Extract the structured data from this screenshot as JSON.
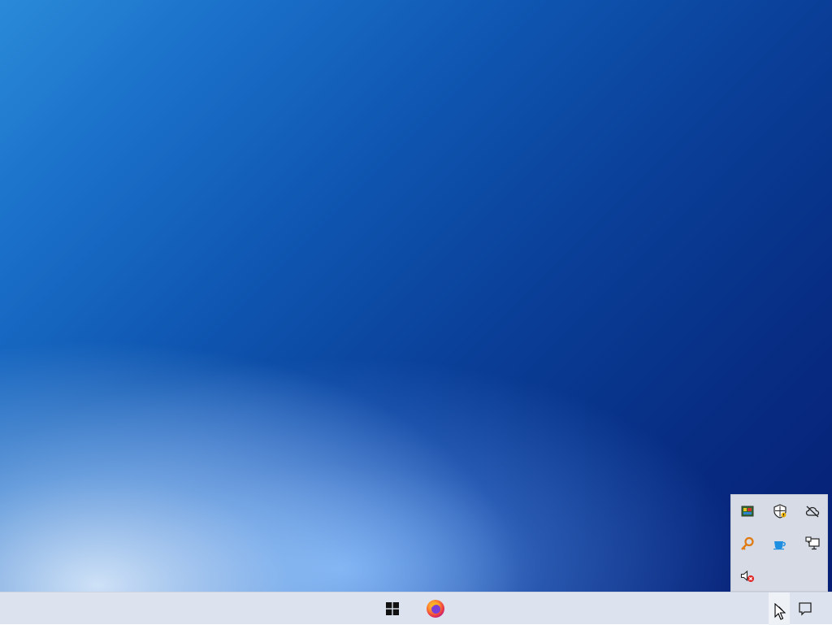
{
  "desktop": {
    "wallpaper": "blue-gradient"
  },
  "tray_overflow": {
    "icons": [
      {
        "name": "image-app-icon",
        "tooltip": ""
      },
      {
        "name": "security-shield-icon",
        "tooltip": ""
      },
      {
        "name": "cloud-offline-icon",
        "tooltip": ""
      },
      {
        "name": "key-icon",
        "tooltip": ""
      },
      {
        "name": "cup-icon",
        "tooltip": ""
      },
      {
        "name": "network-monitor-icon",
        "tooltip": ""
      },
      {
        "name": "speaker-muted-icon",
        "tooltip": ""
      }
    ]
  },
  "taskbar": {
    "apps": [
      {
        "name": "windows-start-icon"
      },
      {
        "name": "firefox-icon"
      }
    ],
    "tray": {
      "show_hidden_icons": "chevron-up-icon",
      "action_center": "notification-icon"
    }
  },
  "colors": {
    "taskbar_bg": "#dde3ee",
    "overflow_bg": "#d6dbe6",
    "accent_blue": "#0a3f98"
  }
}
